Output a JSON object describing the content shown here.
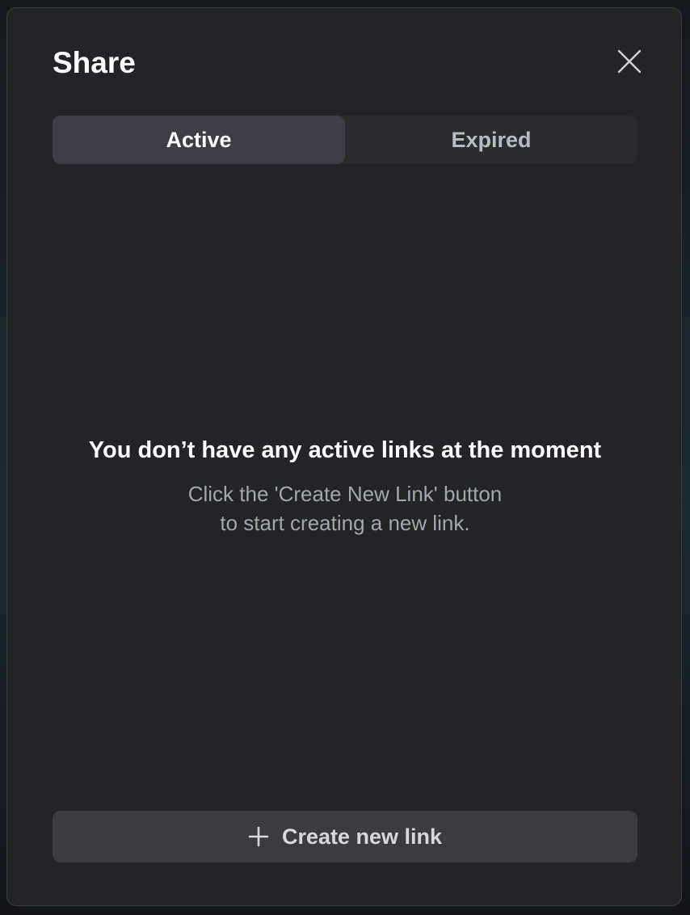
{
  "dialog": {
    "title": "Share"
  },
  "tabs": [
    {
      "label": "Active",
      "selected": true
    },
    {
      "label": "Expired",
      "selected": false
    }
  ],
  "empty_state": {
    "title": "You don’t have any active links at the moment",
    "description_line1": "Click the 'Create New Link' button",
    "description_line2": "to start creating a new link."
  },
  "actions": {
    "create_label": "Create new link"
  },
  "icons": {
    "close": "close-icon",
    "plus": "plus-icon"
  },
  "colors": {
    "dialog_bg": "#232429",
    "tab_active_bg": "#3d3e45",
    "button_bg": "#3b3c42",
    "text_primary": "#ffffff",
    "text_secondary": "#a4a6ad"
  }
}
